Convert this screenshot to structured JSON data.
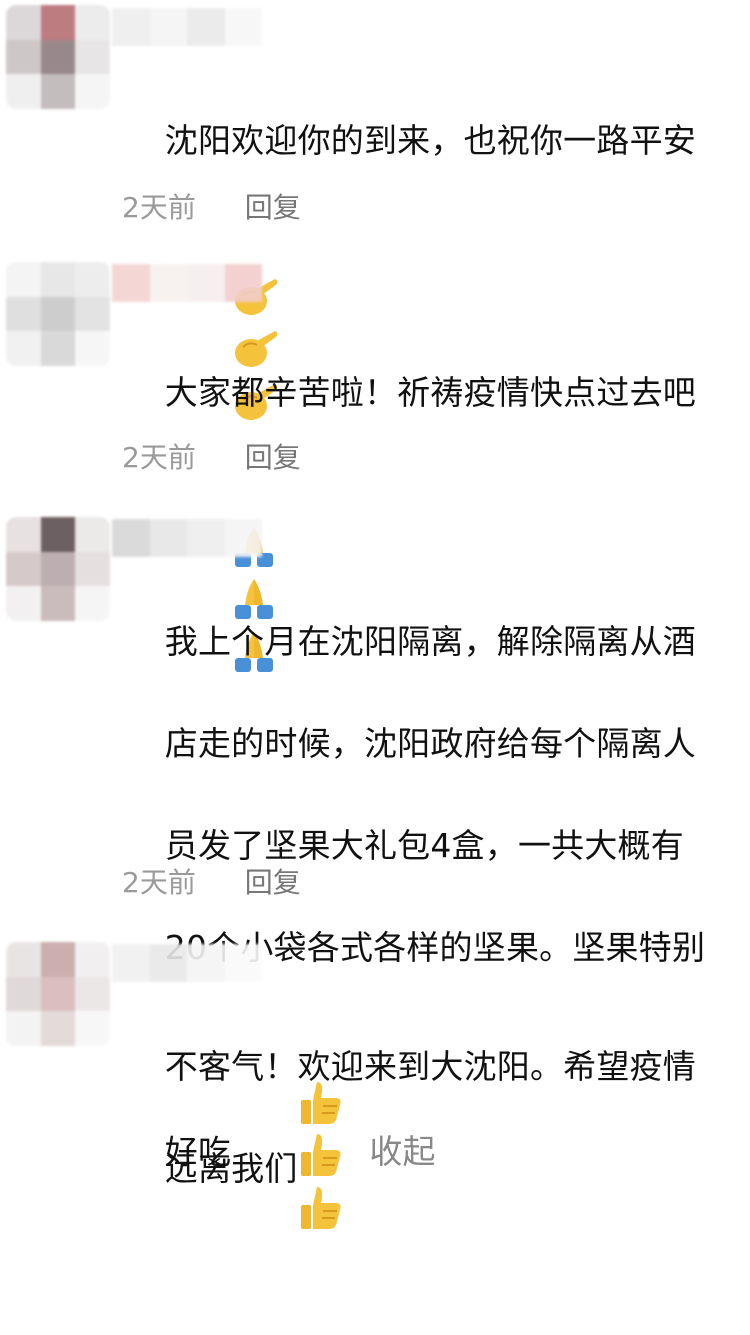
{
  "comments": [
    {
      "text": "沈阳欢迎你的到来，也祝你一路平安",
      "emoji": [
        "pointing-hand-icon",
        "pointing-hand-icon",
        "pointing-hand-icon"
      ],
      "time": "2天前",
      "reply": "回复"
    },
    {
      "text": "大家都辛苦啦！祈祷疫情快点过去吧",
      "emoji": [
        "praying-hands-icon",
        "praying-hands-icon",
        "praying-hands-icon"
      ],
      "time": "2天前",
      "reply": "回复"
    },
    {
      "text_lines": [
        "我上个月在沈阳隔离，解除隔离从酒",
        "店走的时候，沈阳政府给每个隔离人",
        "员发了坚果大礼包4盒，一共大概有",
        "20个小袋各式各样的坚果。坚果特别",
        "好吃"
      ],
      "emoji": [
        "thumbs-up-icon",
        "thumbs-up-icon",
        "thumbs-up-icon"
      ],
      "collapse": "收起",
      "time": "2天前",
      "reply": "回复"
    },
    {
      "text_lines": [
        "不客气！欢迎来到大沈阳。希望疫情",
        "远离我们"
      ]
    }
  ],
  "colors": {
    "meta_text": "#9a9a9a",
    "emoji_yellow": "#f5c33b",
    "prayer_blue": "#4a90d9"
  }
}
